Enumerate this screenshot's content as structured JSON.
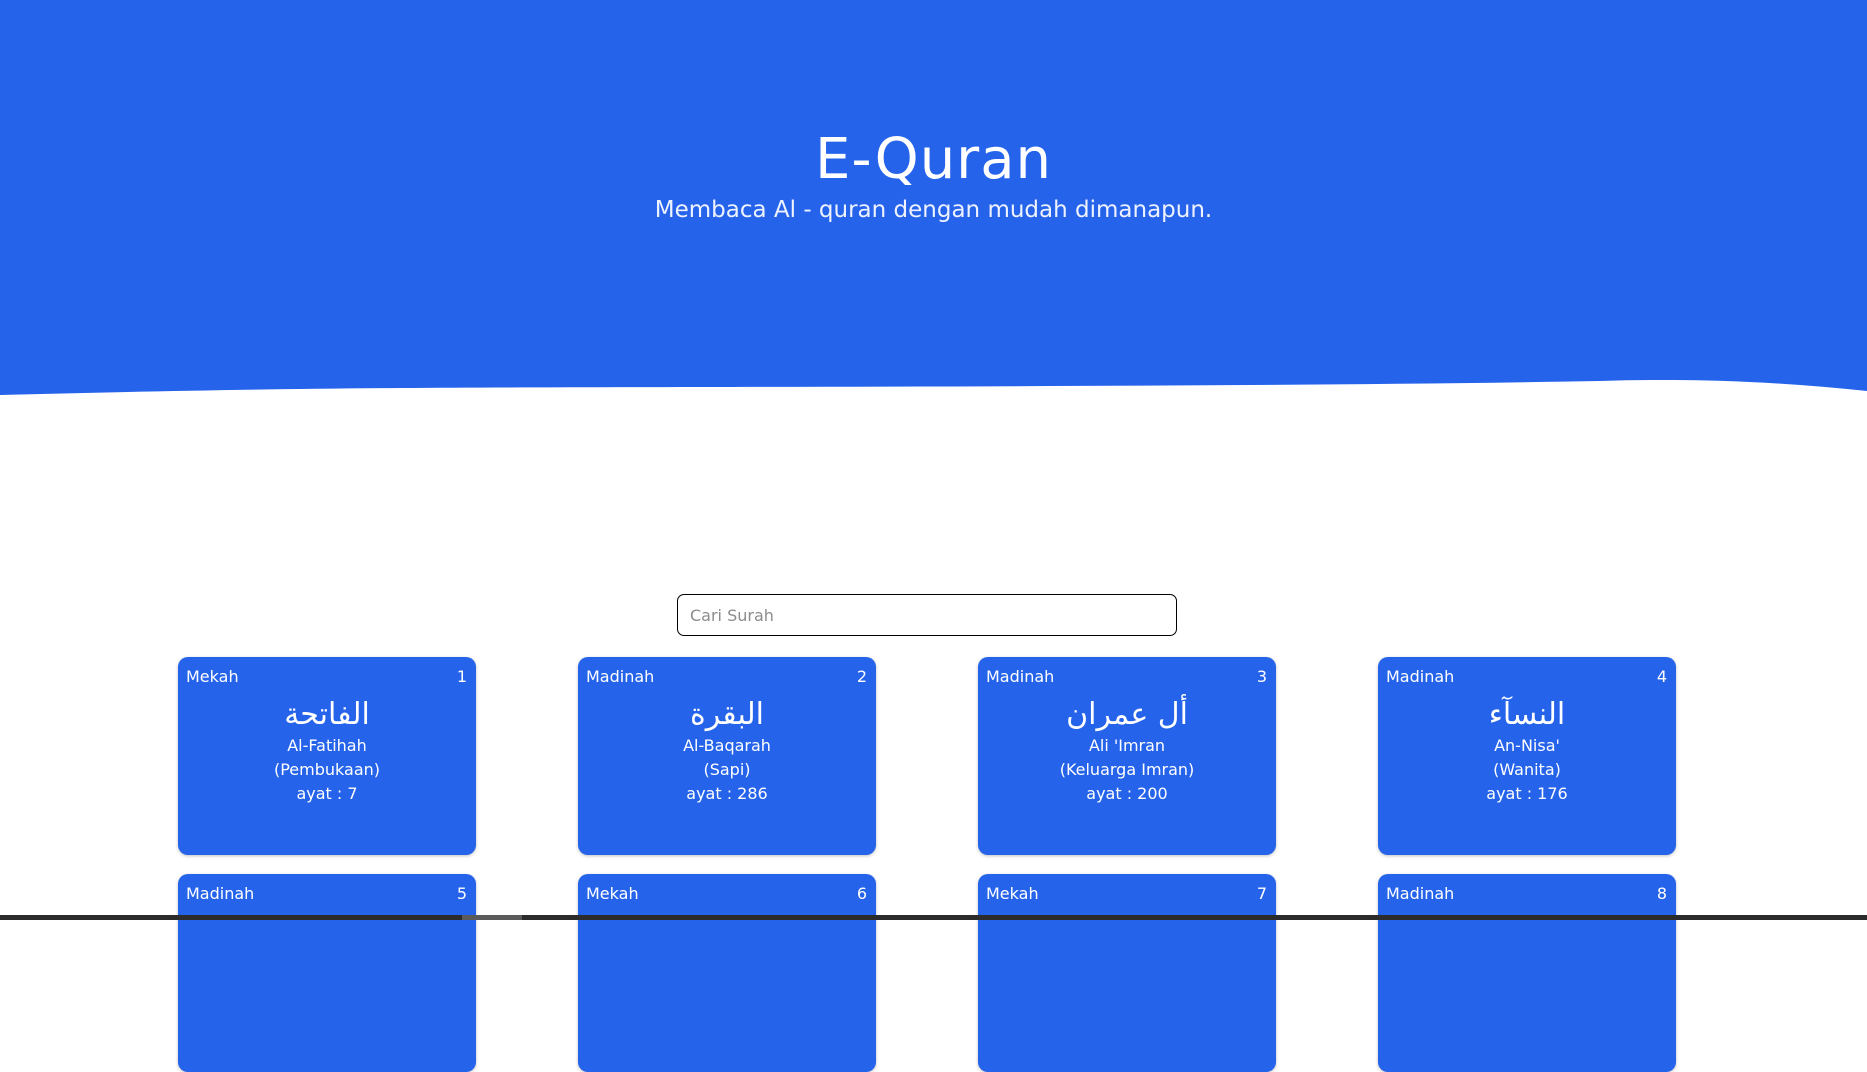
{
  "header": {
    "title": "E-Quran",
    "subtitle": "Membaca Al - quran dengan mudah dimanapun."
  },
  "search": {
    "placeholder": "Cari Surah",
    "value": ""
  },
  "colors": {
    "primary": "#2563eb",
    "background": "#ffffff",
    "text_on_primary": "#ffffff"
  },
  "surahs": [
    {
      "place": "Mekah",
      "number": "1",
      "arabic": "الفاتحة",
      "latin": "Al-Fatihah",
      "meaning": "(Pembukaan)",
      "ayat": "ayat : 7"
    },
    {
      "place": "Madinah",
      "number": "2",
      "arabic": "البقرة",
      "latin": "Al-Baqarah",
      "meaning": "(Sapi)",
      "ayat": "ayat : 286"
    },
    {
      "place": "Madinah",
      "number": "3",
      "arabic": "أل عمران",
      "latin": "Ali 'Imran",
      "meaning": "(Keluarga Imran)",
      "ayat": "ayat : 200"
    },
    {
      "place": "Madinah",
      "number": "4",
      "arabic": "النسآء",
      "latin": "An-Nisa'",
      "meaning": "(Wanita)",
      "ayat": "ayat : 176"
    },
    {
      "place": "Madinah",
      "number": "5"
    },
    {
      "place": "Mekah",
      "number": "6"
    },
    {
      "place": "Mekah",
      "number": "7"
    },
    {
      "place": "Madinah",
      "number": "8"
    }
  ]
}
